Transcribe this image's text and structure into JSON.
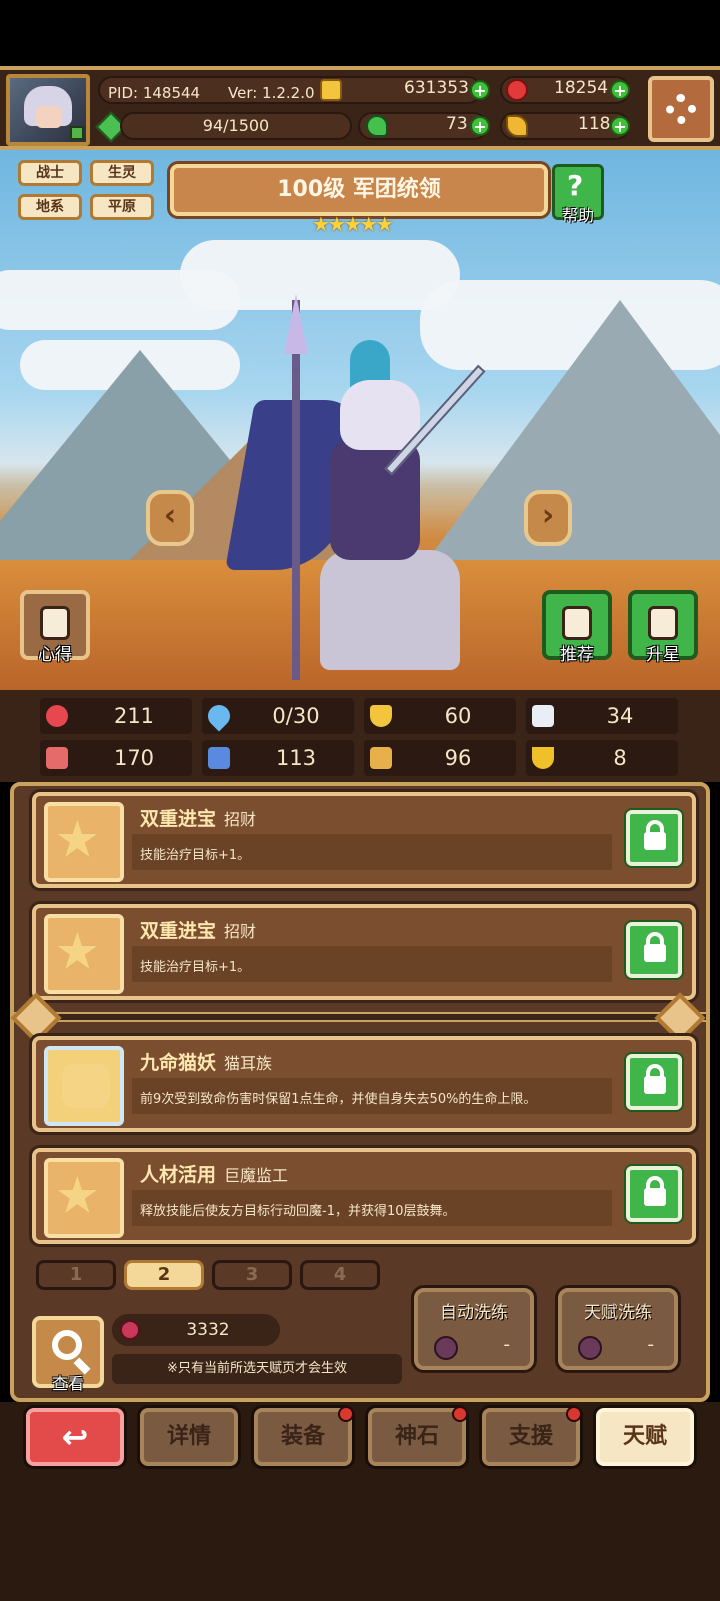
{
  "hud": {
    "pid_label": "PID: 148544",
    "version_label": "Ver: 1.2.2.0",
    "stamina": "94/1500",
    "gold": "631353",
    "ruby": "18254",
    "clover": "73",
    "token": "118"
  },
  "tags": [
    "战士",
    "生灵",
    "地系",
    "平原"
  ],
  "title": "100级  军团统领",
  "stars": "★★★★★",
  "help_label": "帮助",
  "side_buttons": {
    "notes": "心得",
    "recommend": "推荐",
    "star_up": "升星"
  },
  "arrows": {
    "prev": "‹",
    "next": "›"
  },
  "stats": {
    "hp": "211",
    "mana": "0/30",
    "defense": "60",
    "speed": "34",
    "attack": "170",
    "magic": "113",
    "crit": "96",
    "range": "8"
  },
  "stat_colors": {
    "hp": "#e8474f",
    "mana": "#6ab8f0",
    "defense": "#f3c53c",
    "speed": "#e8eef4",
    "attack": "#e56a6a",
    "magic": "#5a8ae0",
    "crit": "#e8b04a",
    "range": "#f0c02a"
  },
  "talents": [
    {
      "name": "双重进宝",
      "tag": "招财",
      "desc": "技能治疗目标+1。"
    },
    {
      "name": "双重进宝",
      "tag": "招财",
      "desc": "技能治疗目标+1。"
    },
    {
      "name": "九命猫妖",
      "tag": "猫耳族",
      "desc": "前9次受到致命伤害时保留1点生命，并使自身失去50%的生命上限。"
    },
    {
      "name": "人材活用",
      "tag": "巨魔监工",
      "desc": "释放技能后使友方目标行动回魔-1，并获得10层鼓舞。"
    }
  ],
  "talent_pages": [
    "1",
    "2",
    "3",
    "4"
  ],
  "active_page": "2",
  "view_label": "查看",
  "fruit_count": "3332",
  "note": "※只有当前所选天赋页才会生效",
  "auto_wash": {
    "label": "自动洗练",
    "value": "-"
  },
  "talent_wash": {
    "label": "天赋洗练",
    "value": "-"
  },
  "nav": {
    "back": "↩",
    "details": "详情",
    "equipment": "装备",
    "divine_stone": "神石",
    "support": "支援",
    "talent": "天赋"
  }
}
